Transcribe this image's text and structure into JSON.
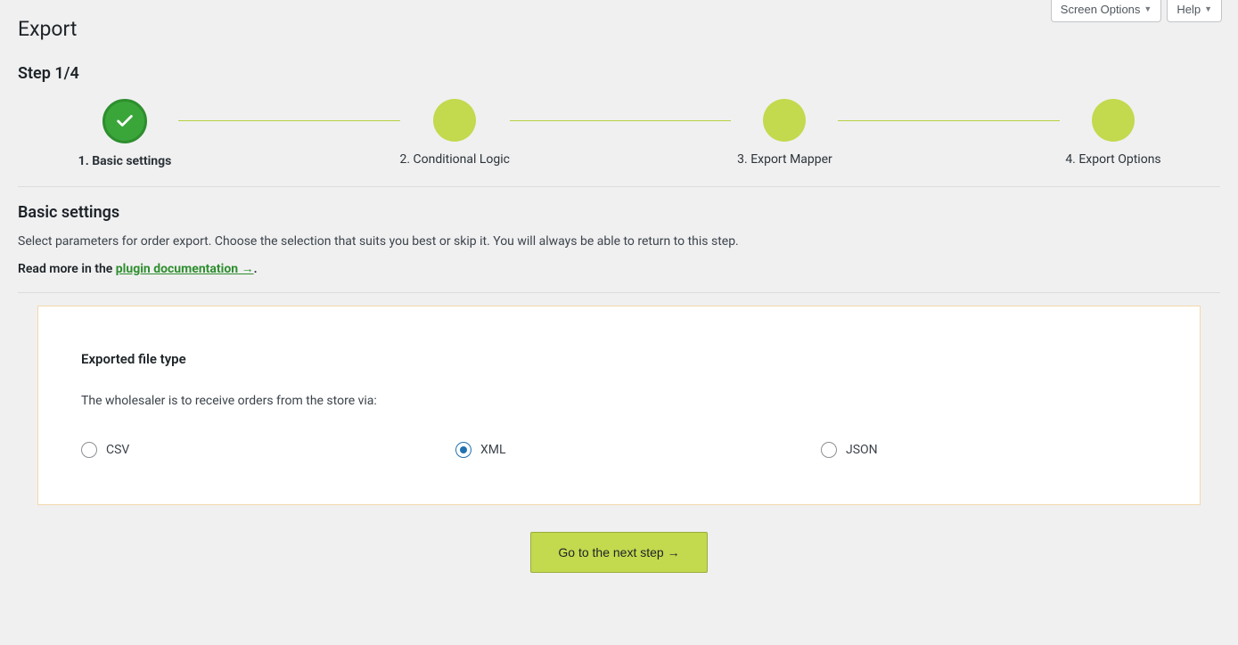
{
  "top": {
    "screen_options": "Screen Options",
    "help": "Help"
  },
  "page_title": "Export",
  "step_title": "Step 1/4",
  "steps": [
    {
      "label": "1. Basic settings",
      "active": true
    },
    {
      "label": "2. Conditional Logic",
      "active": false
    },
    {
      "label": "3. Export Mapper",
      "active": false
    },
    {
      "label": "4. Export Options",
      "active": false
    }
  ],
  "section": {
    "title": "Basic settings",
    "description": "Select parameters for order export. Choose the selection that suits you best or skip it. You will always be able to return to this step.",
    "read_more_prefix": "Read more in the ",
    "read_more_link": "plugin documentation →",
    "read_more_suffix": "."
  },
  "card": {
    "heading": "Exported file type",
    "subtext": "The wholesaler is to receive orders from the store via:",
    "options": {
      "csv": "CSV",
      "xml": "XML",
      "json": "JSON"
    },
    "selected": "xml"
  },
  "next_button": "Go to the next step →"
}
